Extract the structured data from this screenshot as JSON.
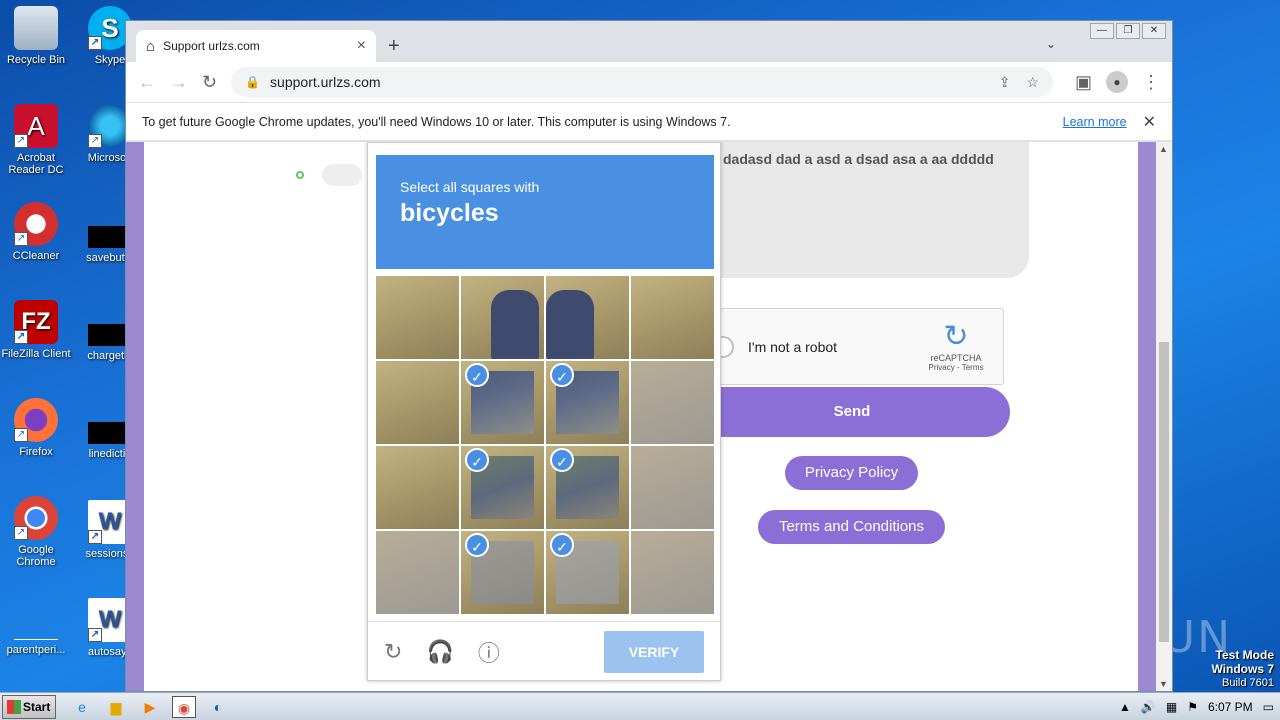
{
  "desktop": {
    "icons": [
      {
        "label": "Recycle Bin",
        "icon": "recycle-bin-icon"
      },
      {
        "label": "Acrobat Reader DC",
        "icon": "acrobat-icon"
      },
      {
        "label": "CCleaner",
        "icon": "ccleaner-icon"
      },
      {
        "label": "FileZilla Client",
        "icon": "filezilla-icon"
      },
      {
        "label": "Firefox",
        "icon": "firefox-icon"
      },
      {
        "label": "Google Chrome",
        "icon": "chrome-icon"
      },
      {
        "label": "parentperi...",
        "icon": "file-icon"
      },
      {
        "label": "Skype",
        "icon": "skype-icon"
      },
      {
        "label": "Microsoft",
        "icon": "edge-icon"
      },
      {
        "label": "savebutto",
        "icon": "file-icon"
      },
      {
        "label": "chargethi",
        "icon": "file-icon"
      },
      {
        "label": "linedictio",
        "icon": "file-icon"
      },
      {
        "label": "sessionsu",
        "icon": "word-icon"
      },
      {
        "label": "autosays",
        "icon": "word-icon"
      }
    ],
    "watermark": "ANY RUN",
    "test_mode": {
      "line1": "Test Mode",
      "line2": "Windows 7",
      "line3": "Build 7601"
    }
  },
  "browser": {
    "tab_title": "Support urlzs.com",
    "url": "support.urlzs.com",
    "infobar_text": "To get future Google Chrome updates, you'll need Windows 10 or later. This computer is using Windows 7.",
    "infobar_link": "Learn more"
  },
  "page": {
    "message_text": "dadasd  dad a asd a dsad asa a aa   ddddd",
    "recaptcha_label": "I'm not a robot",
    "recaptcha_brand": "reCAPTCHA",
    "recaptcha_links": "Privacy - Terms",
    "send_label": "Send",
    "privacy_label": "Privacy Policy",
    "terms_label": "Terms and Conditions"
  },
  "challenge": {
    "instruction": "Select all squares with",
    "target": "bicycles",
    "selected_tiles": [
      5,
      6,
      9,
      10,
      13,
      14
    ],
    "verify_label": "VERIFY"
  },
  "taskbar": {
    "start_label": "Start",
    "clock": "6:07 PM"
  }
}
